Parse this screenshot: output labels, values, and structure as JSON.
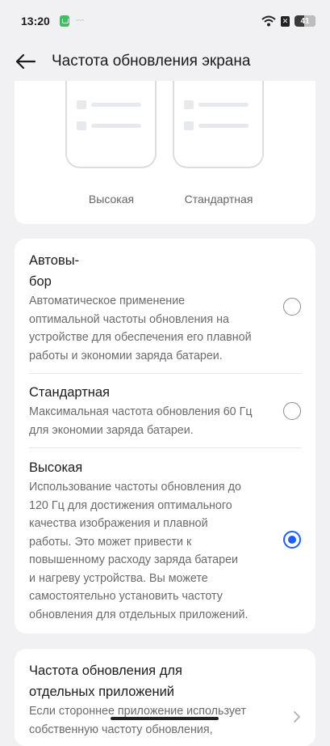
{
  "status": {
    "time": "13:20",
    "tiny_text": "~~~",
    "battery": "41"
  },
  "appbar": {
    "title": "Частота обновления экрана"
  },
  "preview": {
    "high_label": "Высокая",
    "standard_label": "Стандартная"
  },
  "options": [
    {
      "title_line1": "Автовы-",
      "title_line2": "бор",
      "desc_lines": [
        "Автоматическое применение",
        "оптимальной частоты обновления на",
        "устройстве для обеспечения его плавной",
        "работы и экономии заряда батареи."
      ],
      "selected": false
    },
    {
      "title": "Стандартная",
      "desc_lines": [
        "Максимальная частота обновления 60 Гц",
        "для экономии заряда батареи."
      ],
      "selected": false
    },
    {
      "title": "Высокая",
      "desc_lines": [
        "Использование частоты обновления до",
        "120 Гц для достижения оптимального",
        "качества изображения и плавной",
        "работы. Это может привести к",
        "повышенному расходу заряда батареи",
        "и нагреву устройства. Вы можете",
        "самостоятельно установить частоту",
        "обновления для отдельных приложений."
      ],
      "selected": true
    }
  ],
  "per_app": {
    "title_lines": [
      "Частота обновления для",
      "отдельных приложений"
    ],
    "desc_lines": [
      "Если стороннее приложение использует",
      "собственную частоту обновления,"
    ]
  },
  "colors": {
    "accent": "#1a5fff",
    "background": "#f1f1f4"
  }
}
